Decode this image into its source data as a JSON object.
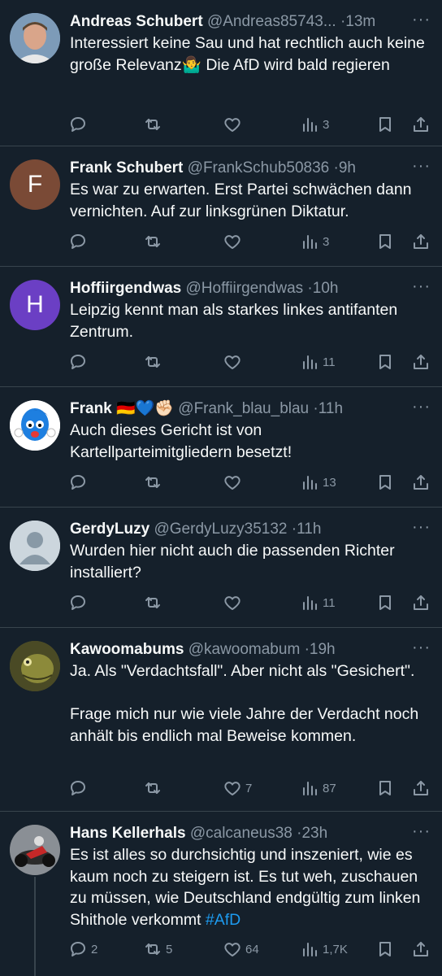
{
  "tweets": [
    {
      "name": "Andreas Schubert",
      "handle": "@Andreas85743...",
      "time": "13m",
      "text": "Interessiert keine Sau und hat rechtlich auch keine große Relevanz🤷‍♂️ Die AfD wird bald regieren",
      "replies": "",
      "retweets": "",
      "likes": "",
      "views": "3",
      "avatar_letter": ""
    },
    {
      "name": "Frank Schubert",
      "handle": "@FrankSchub50836",
      "time": "9h",
      "text": "Es war zu erwarten. Erst Partei schwächen dann vernichten. Auf zur linksgrünen Diktatur.",
      "replies": "",
      "retweets": "",
      "likes": "",
      "views": "3",
      "avatar_letter": "F"
    },
    {
      "name": "Hoffiirgendwas",
      "handle": "@Hoffiirgendwas",
      "time": "10h",
      "text": "Leipzig kennt man als starkes linkes antifanten Zentrum.",
      "replies": "",
      "retweets": "",
      "likes": "",
      "views": "11",
      "avatar_letter": "H"
    },
    {
      "name": "Frank 🇩🇪💙✊🏻",
      "handle": "@Frank_blau_blau",
      "time": "11h",
      "text": "Auch dieses Gericht ist von Kartellparteimitgliedern besetzt!",
      "replies": "",
      "retweets": "",
      "likes": "",
      "views": "13",
      "avatar_letter": ""
    },
    {
      "name": "GerdyLuzy",
      "handle": "@GerdyLuzy35132",
      "time": "11h",
      "text": "Wurden hier nicht auch die passenden Richter installiert?",
      "replies": "",
      "retweets": "",
      "likes": "",
      "views": "11",
      "avatar_letter": ""
    },
    {
      "name": "Kawoomabums",
      "handle": "@kawoomabum",
      "time": "19h",
      "text": "Ja. Als \"Verdachtsfall\". Aber nicht als \"Gesichert\".\n\nFrage mich nur wie viele Jahre der Verdacht noch anhält bis endlich mal Beweise kommen.",
      "replies": "",
      "retweets": "",
      "likes": "7",
      "views": "87",
      "avatar_letter": ""
    },
    {
      "name": "Hans Kellerhals",
      "handle": "@calcaneus38",
      "time": "23h",
      "text": "Es ist alles so durchsichtig und inszeniert, wie es kaum noch zu steigern ist. Es tut weh, zuschauen zu müssen, wie Deutschland endgültig zum linken Shithole verkommt ",
      "hashtag": "#AfD",
      "replies": "2",
      "retweets": "5",
      "likes": "64",
      "views": "1,7K",
      "avatar_letter": ""
    }
  ],
  "separator": "·",
  "more_glyph": "···",
  "colors": {
    "background": "#15202b",
    "text": "#f7f9f9",
    "muted": "#8b98a5",
    "link": "#1d9bf0",
    "divider": "#38444d"
  }
}
